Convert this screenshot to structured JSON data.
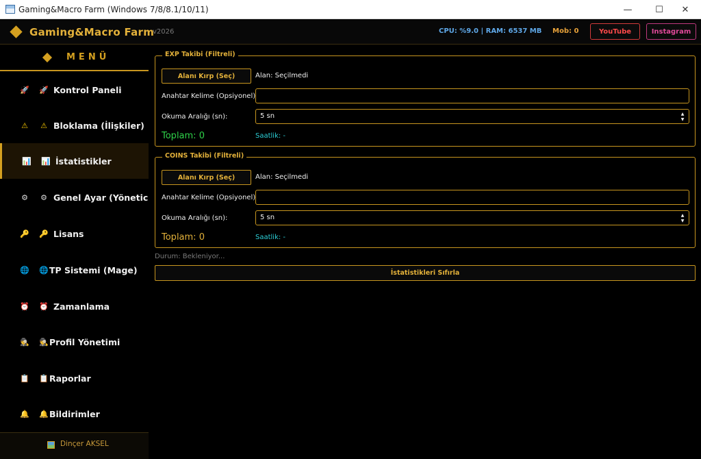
{
  "window": {
    "title": "Gaming&Macro Farm (Windows 7/8/8.1/10/11)",
    "minimize_glyph": "—",
    "maximize_glyph": "☐",
    "close_glyph": "✕"
  },
  "header": {
    "app_name": "Gaming&Macro Farm",
    "version": "v2026",
    "cpu_ram": "CPU: %9.0 | RAM: 6537 MB",
    "mob": "Mob: 0",
    "youtube_label": "YouTube",
    "instagram_label": "Instagram"
  },
  "sidebar": {
    "menu_title": "MENÜ",
    "items": [
      {
        "label": "Kontrol Paneli",
        "icon": "rocket-icon",
        "glyph": "🚀"
      },
      {
        "label": "Bloklama (İlişkiler)",
        "icon": "warning-icon",
        "glyph": "⚠"
      },
      {
        "label": "İstatistikler",
        "icon": "bar-chart-icon",
        "glyph": "📊"
      },
      {
        "label": "Genel Ayar (Yönetici)",
        "icon": "gear-icon",
        "glyph": "⚙"
      },
      {
        "label": "Lisans",
        "icon": "key-icon",
        "glyph": "🔑"
      },
      {
        "label": "TP Sistemi (Mage)",
        "icon": "globe-icon",
        "glyph": "🌐"
      },
      {
        "label": "Zamanlama",
        "icon": "alarm-clock-icon",
        "glyph": "⏰"
      },
      {
        "label": "Profil Yönetimi",
        "icon": "spy-icon",
        "glyph": "🕵"
      },
      {
        "label": "Raporlar",
        "icon": "clipboard-icon",
        "glyph": "📋"
      },
      {
        "label": "Bildirimler",
        "icon": "bell-icon",
        "glyph": "🔔"
      }
    ],
    "active_index": 2,
    "footer_user": "Dinçer AKSEL"
  },
  "exp": {
    "legend": "EXP Takibi (Filtreli)",
    "crop_button": "Alanı Kırp (Seç)",
    "area_label": "Alan: Seçilmedi",
    "keyword_label": "Anahtar Kelime (Opsiyonel):",
    "keyword_value": "",
    "interval_label": "Okuma Aralığı (sn):",
    "interval_value": "5 sn",
    "total": "Toplam: 0",
    "total_color": "#2fd34a",
    "hourly": "Saatlik: -"
  },
  "coins": {
    "legend": "COINS Takibi (Filtreli)",
    "crop_button": "Alanı Kırp (Seç)",
    "area_label": "Alan: Seçilmedi",
    "keyword_label": "Anahtar Kelime (Opsiyonel):",
    "keyword_value": "",
    "interval_label": "Okuma Aralığı (sn):",
    "interval_value": "5 sn",
    "total": "Toplam: 0",
    "total_color": "#e3b13a",
    "hourly": "Saatlik: -"
  },
  "status_text": "Durum: Bekleniyor...",
  "reset_button": "İstatistikleri Sıfırla",
  "colors": {
    "accent": "#d4a020",
    "background": "#000000",
    "youtube": "#ff4a4a",
    "instagram": "#e0499a",
    "cpu": "#5fa8e8",
    "hourly": "#2cd0d8"
  }
}
